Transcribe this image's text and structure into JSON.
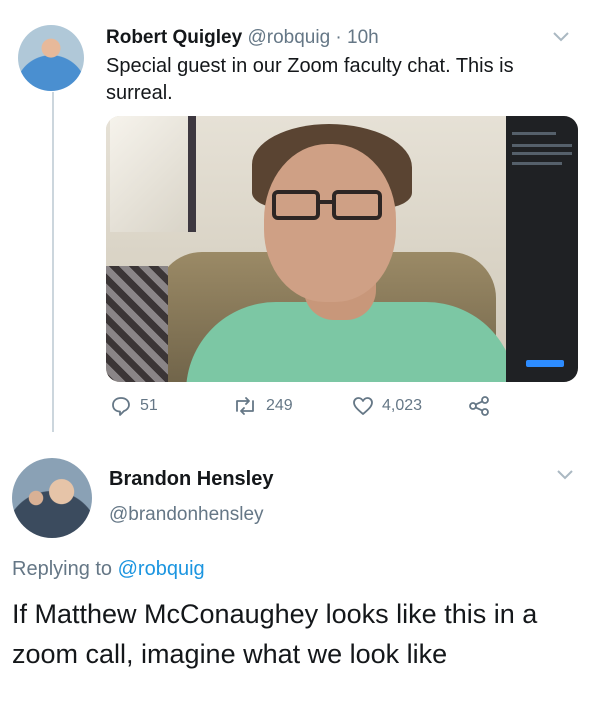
{
  "tweet1": {
    "author_name": "Robert Quigley",
    "author_handle": "@robquig",
    "time": " · 10h",
    "text": "Special guest in our Zoom faculty chat. This is surreal.",
    "counts": {
      "replies": "51",
      "retweets": "249",
      "likes": "4,023"
    }
  },
  "tweet2": {
    "author_name": "Brandon Hensley",
    "author_handle": "@brandonhensley",
    "replying_prefix": "Replying to ",
    "replying_handle": "@robquig",
    "text": "If Matthew McConaughey looks like this in a zoom call, imagine what we look like"
  },
  "icons": {
    "reply": "speech-bubble-icon",
    "retweet": "retweet-icon",
    "like": "heart-icon",
    "share": "share-icon",
    "menu": "chevron-down-icon"
  },
  "colors": {
    "link": "#1b95e0",
    "secondary": "#657786",
    "text": "#14171a",
    "zoom_button": "#2d8cff"
  }
}
